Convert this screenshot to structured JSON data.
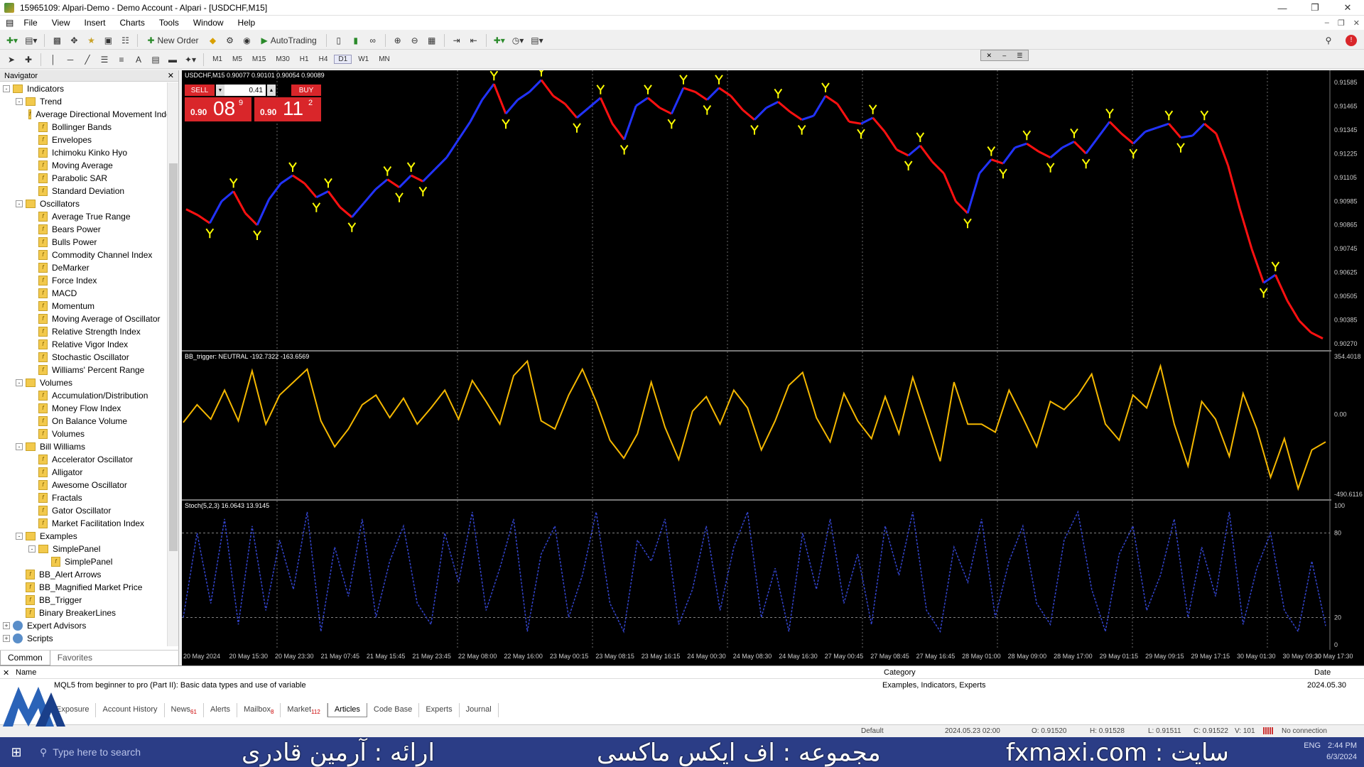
{
  "window": {
    "title": "15965109: Alpari-Demo - Demo Account - Alpari - [USDCHF,M15]"
  },
  "menu": [
    "File",
    "View",
    "Insert",
    "Charts",
    "Tools",
    "Window",
    "Help"
  ],
  "toolbar": {
    "new_order": "New Order",
    "auto_trading": "AutoTrading"
  },
  "timeframes": [
    "M1",
    "M5",
    "M15",
    "M30",
    "H1",
    "H4",
    "D1",
    "W1",
    "MN"
  ],
  "active_timeframe": "D1",
  "navigator": {
    "title": "Navigator",
    "tree": [
      {
        "label": "Indicators",
        "level": 0,
        "kind": "folder",
        "exp": "-"
      },
      {
        "label": "Trend",
        "level": 1,
        "kind": "folder",
        "exp": "-"
      },
      {
        "label": "Average Directional Movement Index",
        "level": 2,
        "kind": "ind"
      },
      {
        "label": "Bollinger Bands",
        "level": 2,
        "kind": "ind"
      },
      {
        "label": "Envelopes",
        "level": 2,
        "kind": "ind"
      },
      {
        "label": "Ichimoku Kinko Hyo",
        "level": 2,
        "kind": "ind"
      },
      {
        "label": "Moving Average",
        "level": 2,
        "kind": "ind"
      },
      {
        "label": "Parabolic SAR",
        "level": 2,
        "kind": "ind"
      },
      {
        "label": "Standard Deviation",
        "level": 2,
        "kind": "ind"
      },
      {
        "label": "Oscillators",
        "level": 1,
        "kind": "folder",
        "exp": "-"
      },
      {
        "label": "Average True Range",
        "level": 2,
        "kind": "ind"
      },
      {
        "label": "Bears Power",
        "level": 2,
        "kind": "ind"
      },
      {
        "label": "Bulls Power",
        "level": 2,
        "kind": "ind"
      },
      {
        "label": "Commodity Channel Index",
        "level": 2,
        "kind": "ind"
      },
      {
        "label": "DeMarker",
        "level": 2,
        "kind": "ind"
      },
      {
        "label": "Force Index",
        "level": 2,
        "kind": "ind"
      },
      {
        "label": "MACD",
        "level": 2,
        "kind": "ind"
      },
      {
        "label": "Momentum",
        "level": 2,
        "kind": "ind"
      },
      {
        "label": "Moving Average of Oscillator",
        "level": 2,
        "kind": "ind"
      },
      {
        "label": "Relative Strength Index",
        "level": 2,
        "kind": "ind"
      },
      {
        "label": "Relative Vigor Index",
        "level": 2,
        "kind": "ind"
      },
      {
        "label": "Stochastic Oscillator",
        "level": 2,
        "kind": "ind"
      },
      {
        "label": "Williams' Percent Range",
        "level": 2,
        "kind": "ind"
      },
      {
        "label": "Volumes",
        "level": 1,
        "kind": "folder",
        "exp": "-"
      },
      {
        "label": "Accumulation/Distribution",
        "level": 2,
        "kind": "ind"
      },
      {
        "label": "Money Flow Index",
        "level": 2,
        "kind": "ind"
      },
      {
        "label": "On Balance Volume",
        "level": 2,
        "kind": "ind"
      },
      {
        "label": "Volumes",
        "level": 2,
        "kind": "ind"
      },
      {
        "label": "Bill Williams",
        "level": 1,
        "kind": "folder",
        "exp": "-"
      },
      {
        "label": "Accelerator Oscillator",
        "level": 2,
        "kind": "ind"
      },
      {
        "label": "Alligator",
        "level": 2,
        "kind": "ind"
      },
      {
        "label": "Awesome Oscillator",
        "level": 2,
        "kind": "ind"
      },
      {
        "label": "Fractals",
        "level": 2,
        "kind": "ind"
      },
      {
        "label": "Gator Oscillator",
        "level": 2,
        "kind": "ind"
      },
      {
        "label": "Market Facilitation Index",
        "level": 2,
        "kind": "ind"
      },
      {
        "label": "Examples",
        "level": 1,
        "kind": "folder",
        "exp": "-"
      },
      {
        "label": "SimplePanel",
        "level": 2,
        "kind": "folder",
        "exp": "-"
      },
      {
        "label": "SimplePanel",
        "level": 3,
        "kind": "ind"
      },
      {
        "label": "BB_Alert Arrows",
        "level": 1,
        "kind": "ind"
      },
      {
        "label": "BB_Magnified Market Price",
        "level": 1,
        "kind": "ind"
      },
      {
        "label": "BB_Trigger",
        "level": 1,
        "kind": "ind"
      },
      {
        "label": "Binary BreakerLines",
        "level": 1,
        "kind": "ind"
      },
      {
        "label": "Expert Advisors",
        "level": 0,
        "kind": "globe",
        "exp": "+"
      },
      {
        "label": "Scripts",
        "level": 0,
        "kind": "globe",
        "exp": "+"
      }
    ],
    "tabs": [
      "Common",
      "Favorites"
    ]
  },
  "chart": {
    "symbol_header": "USDCHF,M15  0.90077 0.90101 0.90054 0.90089",
    "sell_label": "SELL",
    "buy_label": "BUY",
    "lot": "0.41",
    "sell_price": {
      "pre": "0.90",
      "big": "08",
      "pt": "9"
    },
    "buy_price": {
      "pre": "0.90",
      "big": "11",
      "pt": "2"
    },
    "price_axis": [
      "0.91585",
      "0.91465",
      "0.91345",
      "0.91225",
      "0.91105",
      "0.90985",
      "0.90865",
      "0.90745",
      "0.90625",
      "0.90505",
      "0.90385",
      "0.90270"
    ],
    "bb_label": "BB_trigger: NEUTRAL -192.7322 -163.6569",
    "bb_axis": [
      "354.4018",
      "0.00",
      "-490.6116"
    ],
    "stoch_label": "Stoch(5,2,3) 16.0643 13.9145",
    "stoch_axis": [
      "100",
      "80",
      "20",
      "0"
    ],
    "time_labels": [
      "20 May 2024",
      "20 May 15:30",
      "20 May 23:30",
      "21 May 07:45",
      "21 May 15:45",
      "21 May 23:45",
      "22 May 08:00",
      "22 May 16:00",
      "23 May 00:15",
      "23 May 08:15",
      "23 May 16:15",
      "24 May 00:30",
      "24 May 08:30",
      "24 May 16:30",
      "27 May 00:45",
      "27 May 08:45",
      "27 May 16:45",
      "28 May 01:00",
      "28 May 09:00",
      "28 May 17:00",
      "29 May 01:15",
      "29 May 09:15",
      "29 May 17:15",
      "30 May 01:30",
      "30 May 09:30",
      "30 May 17:30"
    ]
  },
  "chart_data": [
    {
      "type": "line",
      "title": "USDCHF,M15",
      "ylim": [
        0.9027,
        0.9162
      ],
      "series": [
        {
          "name": "USDCHF",
          "values": [
            0.9095,
            0.9092,
            0.9088,
            0.9099,
            0.9104,
            0.9093,
            0.9087,
            0.91,
            0.9108,
            0.9112,
            0.9108,
            0.9101,
            0.9104,
            0.9096,
            0.9091,
            0.9098,
            0.9105,
            0.911,
            0.9106,
            0.9112,
            0.9109,
            0.9115,
            0.9121,
            0.913,
            0.9139,
            0.915,
            0.9158,
            0.9143,
            0.915,
            0.9154,
            0.916,
            0.9152,
            0.9148,
            0.9141,
            0.9146,
            0.9151,
            0.9138,
            0.913,
            0.9147,
            0.9151,
            0.9146,
            0.9143,
            0.9156,
            0.9154,
            0.915,
            0.9156,
            0.9152,
            0.9145,
            0.914,
            0.9146,
            0.9149,
            0.9144,
            0.914,
            0.9142,
            0.9152,
            0.9148,
            0.9139,
            0.9138,
            0.9141,
            0.9134,
            0.9125,
            0.9122,
            0.9127,
            0.9119,
            0.9113,
            0.9099,
            0.9093,
            0.9113,
            0.912,
            0.9118,
            0.9126,
            0.9128,
            0.9124,
            0.9121,
            0.9126,
            0.9129,
            0.9123,
            0.9131,
            0.9139,
            0.9133,
            0.9128,
            0.9134,
            0.9136,
            0.9138,
            0.9131,
            0.9132,
            0.9138,
            0.9133,
            0.9117,
            0.9095,
            0.9075,
            0.9058,
            0.9062,
            0.9049,
            0.9039,
            0.9033,
            0.903
          ]
        }
      ]
    },
    {
      "type": "line",
      "title": "BB_trigger: NEUTRAL -192.7322 -163.6569",
      "ylim": [
        -490.6116,
        354.4018
      ],
      "series": [
        {
          "name": "BB_trigger",
          "values": [
            -50,
            60,
            -30,
            150,
            -40,
            270,
            -60,
            120,
            200,
            280,
            -40,
            -200,
            -90,
            60,
            120,
            -20,
            100,
            -60,
            40,
            150,
            -30,
            210,
            80,
            -60,
            240,
            330,
            -40,
            -90,
            120,
            280,
            80,
            -160,
            -270,
            -120,
            200,
            -80,
            -280,
            20,
            110,
            -60,
            150,
            40,
            -220,
            -40,
            180,
            260,
            -20,
            -170,
            130,
            -40,
            -150,
            110,
            -120,
            230,
            -30,
            -290,
            200,
            -60,
            -60,
            -110,
            150,
            -20,
            -200,
            80,
            30,
            120,
            250,
            -60,
            -160,
            120,
            40,
            300,
            -60,
            -320,
            80,
            -30,
            -260,
            130,
            -90,
            -390,
            -150,
            -460,
            -220,
            -170
          ]
        }
      ]
    },
    {
      "type": "line",
      "title": "Stoch(5,2,3) 16.0643 13.9145",
      "ylim": [
        0,
        100
      ],
      "series": [
        {
          "name": "Stoch(5,2,3)",
          "values": [
            20,
            80,
            30,
            90,
            15,
            85,
            25,
            75,
            40,
            95,
            10,
            70,
            35,
            90,
            20,
            60,
            85,
            30,
            15,
            80,
            45,
            95,
            25,
            55,
            90,
            10,
            65,
            85,
            20,
            50,
            95,
            30,
            10,
            75,
            60,
            90,
            15,
            40,
            85,
            25,
            70,
            95,
            20,
            55,
            10,
            80,
            40,
            90,
            30,
            65,
            15,
            85,
            50,
            95,
            25,
            10,
            70,
            45,
            90,
            20,
            60,
            85,
            30,
            15,
            75,
            95,
            40,
            10,
            65,
            85,
            25,
            50,
            90,
            20,
            70,
            35,
            95,
            15,
            55,
            80,
            25,
            10,
            60,
            14
          ]
        }
      ]
    }
  ],
  "bottom": {
    "columns": {
      "name": "Name",
      "category": "Category",
      "date": "Date"
    },
    "row": {
      "name": "MQL5 from beginner to pro (Part II): Basic data types and use of variable",
      "category": "Examples, Indicators, Experts",
      "date": "2024.05.30"
    },
    "tabs": [
      {
        "label": "Exposure",
        "badge": ""
      },
      {
        "label": "Account History",
        "badge": ""
      },
      {
        "label": "News",
        "badge": "61"
      },
      {
        "label": "Alerts",
        "badge": ""
      },
      {
        "label": "Mailbox",
        "badge": "8"
      },
      {
        "label": "Market",
        "badge": "112"
      },
      {
        "label": "Articles",
        "badge": ""
      },
      {
        "label": "Code Base",
        "badge": ""
      },
      {
        "label": "Experts",
        "badge": ""
      },
      {
        "label": "Journal",
        "badge": ""
      }
    ],
    "active_tab": "Articles"
  },
  "status": {
    "profile": "Default",
    "time": "2024.05.23 02:00",
    "o": "O: 0.91520",
    "h": "H: 0.91528",
    "l": "L: 0.91511",
    "c": "C: 0.91522",
    "v": "V: 101",
    "conn": "No connection"
  },
  "taskbar": {
    "search_placeholder": "Type here to search",
    "overlay_left": "ارائه : آرمین قادری",
    "overlay_mid": "مجموعه : اف ایکس ماکسی",
    "overlay_right": "fxmaxi.com : سایت",
    "clock": "2:44 PM",
    "date": "6/3/2024",
    "lang": "ENG"
  },
  "colors": {
    "bull": "#2233ff",
    "bear": "#ff1111",
    "bb_line": "#f5b800",
    "stoch": "#3344cc",
    "arrow": "#ffff00"
  }
}
